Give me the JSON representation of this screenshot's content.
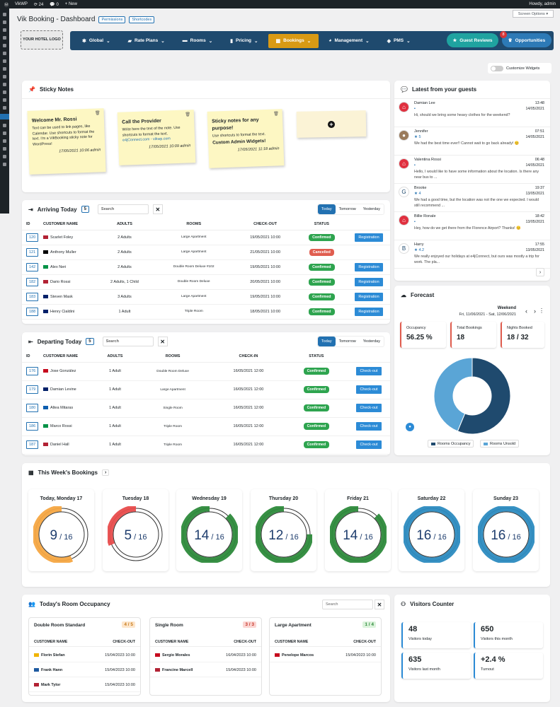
{
  "wp": {
    "site": "VikWP",
    "updates": "24",
    "comments": "0",
    "new": "+ New",
    "howdy": "Howdy, admin",
    "screen_options": "Screen Options ▾"
  },
  "page": {
    "title": "Vik Booking - Dashboard",
    "permissions": "Permissions",
    "shortcodes": "Shortcodes",
    "logo": "YOUR HOTEL LOGO"
  },
  "menu": {
    "items": [
      "Global",
      "Rate Plans",
      "Rooms",
      "Pricing",
      "Bookings",
      "Management",
      "PMS"
    ],
    "guest_reviews": "Guest Reviews",
    "opportunities": "Opportunities",
    "opp_count": "8"
  },
  "customize": "Customize Widgets",
  "sticky": {
    "title": "Sticky Notes",
    "notes": [
      {
        "title": "Welcome Mr. Rossi",
        "body": "Text can be used to link pages, like Calendar. Use shortcuts to format the text. I'm a VikBooking sticky note for WordPress!",
        "date": "17/05/2021 10:06 admin"
      },
      {
        "title": "Call the Provider",
        "body": "Write here the text of the note. Use shortcuts to format the text.",
        "link": "e4jConnect.com - vikwp.com",
        "date": "17/05/2021 10:09 admin"
      },
      {
        "title": "Sticky notes for any purpose!",
        "body": "Use shortcuts to format the text.",
        "body2": "Custom Admin Widgets!",
        "date": "17/05/2021 11:18 admin"
      }
    ]
  },
  "arriving": {
    "title": "Arriving Today",
    "count": "5",
    "search": "Search",
    "tabs": [
      "Today",
      "Tomorrow",
      "Yesterday"
    ],
    "cols": [
      "ID",
      "CUSTOMER NAME",
      "ADULTS",
      "ROOMS",
      "CHECK-OUT",
      "STATUS"
    ],
    "rows": [
      {
        "id": "120",
        "name": "Scarlet Foley",
        "adults": "2 Adults",
        "room": "Large Apartment",
        "date": "19/05/2021 10:00",
        "status": "Confirmed",
        "action": "Registration"
      },
      {
        "id": "121",
        "name": "Anthony Muller",
        "adults": "2 Adults",
        "room": "Large Apartment",
        "date": "21/05/2021 10:00",
        "status": "Cancelled",
        "action": ""
      },
      {
        "id": "142",
        "name": "Alex Neri",
        "adults": "2 Adults",
        "room": "Double Room Deluxe #102",
        "date": "19/05/2021 10:00",
        "status": "Confirmed",
        "action": "Registration"
      },
      {
        "id": "182",
        "name": "Dario Rossi",
        "adults": "2 Adults, 1 Child",
        "room": "Double Room Deluxe",
        "date": "20/05/2021 10:00",
        "status": "Confirmed",
        "action": "Registration"
      },
      {
        "id": "183",
        "name": "Steven Mask",
        "adults": "3 Adults",
        "room": "Large Apartment",
        "date": "19/05/2021 10:00",
        "status": "Confirmed",
        "action": "Registration"
      },
      {
        "id": "188",
        "name": "Henry Cialdini",
        "adults": "1 Adult",
        "room": "Triple Room",
        "date": "18/05/2021 10:00",
        "status": "Confirmed",
        "action": "Registration"
      }
    ]
  },
  "departing": {
    "title": "Departing Today",
    "count": "5",
    "search": "Search",
    "tabs": [
      "Today",
      "Tomorrow",
      "Yesterday"
    ],
    "cols": [
      "ID",
      "CUSTOMER NAME",
      "ADULTS",
      "ROOMS",
      "CHECK-IN",
      "STATUS"
    ],
    "rows": [
      {
        "id": "176",
        "name": "Jose González",
        "adults": "1 Adult",
        "room": "Double Room Deluxe",
        "date": "16/05/2021 12:00",
        "status": "Confirmed",
        "action": "Check-out"
      },
      {
        "id": "179",
        "name": "Damian Levine",
        "adults": "1 Adult",
        "room": "Large Apartment",
        "date": "16/05/2021 12:00",
        "status": "Confirmed",
        "action": "Check-out"
      },
      {
        "id": "180",
        "name": "Altea Mitaras",
        "adults": "1 Adult",
        "room": "Single Room",
        "date": "16/05/2021 12:00",
        "status": "Confirmed",
        "action": "Check-out"
      },
      {
        "id": "186",
        "name": "Marco Rossi",
        "adults": "1 Adult",
        "room": "Triple Room",
        "date": "16/05/2021 12:00",
        "status": "Confirmed",
        "action": "Check-out"
      },
      {
        "id": "187",
        "name": "Daniel Hall",
        "adults": "1 Adult",
        "room": "Triple Room",
        "date": "16/05/2021 12:00",
        "status": "Confirmed",
        "action": "Check-out"
      }
    ]
  },
  "guests": {
    "title": "Latest from your guests",
    "items": [
      {
        "name": "Damian Lee",
        "sub": "",
        "text": "Hi, should we bring some heavy clothes for the weekend?",
        "time": "13:48",
        "date": "14/05/2021"
      },
      {
        "name": "Jennifer",
        "sub": "5",
        "text": "We had the best time ever!! Cannot wait to go back already! 😊",
        "time": "07:51",
        "date": "14/05/2021"
      },
      {
        "name": "Valentina Rossi",
        "sub": "",
        "text": "Hello, I would like to have some information about the location. Is there any near bus to ...",
        "time": "06:48",
        "date": "14/05/2021"
      },
      {
        "name": "Brooke",
        "sub": "4",
        "text": "We had a good time, but the location was not the one we expected. I would still recommend ...",
        "time": "19:37",
        "date": "13/05/2021"
      },
      {
        "name": "Billie Ronale",
        "sub": "",
        "text": "Hey, how do we get there from the Florence Airport? Thanks! 😊",
        "time": "18:42",
        "date": "13/05/2021"
      },
      {
        "name": "Harry",
        "sub": "4.2",
        "text": "We really enjoyed our holidays at e4jConnect, but ours was mostly a trip for work. The pla...",
        "time": "17:55",
        "date": "13/05/2021"
      }
    ]
  },
  "forecast": {
    "title": "Forecast",
    "period": "Weekend",
    "range": "Fri, 11/06/2021 - Sat, 12/06/2021",
    "occupancy_label": "Occupancy",
    "occupancy": "56.25 %",
    "total_label": "Total Bookings",
    "total": "18",
    "nights_label": "Nights Booked",
    "nights": "18 / 32",
    "legend": [
      "Rooms Occupancy",
      "Rooms Unsold"
    ]
  },
  "chart_data": {
    "type": "pie",
    "categories": [
      "Rooms Occupancy",
      "Rooms Unsold"
    ],
    "values": [
      56.25,
      43.75
    ],
    "colors": [
      "#1f4a6e",
      "#5aa5d6"
    ]
  },
  "week": {
    "title": "This Week's Bookings",
    "days": [
      {
        "label": "Today, Monday 17",
        "value": "9",
        "total": "16",
        "color": "#f5a742"
      },
      {
        "label": "Tuesday 18",
        "value": "5",
        "total": "16",
        "color": "#e84c4c"
      },
      {
        "label": "Wednesday 19",
        "value": "14",
        "total": "16",
        "color": "#2d8a3b"
      },
      {
        "label": "Thursday 20",
        "value": "12",
        "total": "16",
        "color": "#2d8a3b"
      },
      {
        "label": "Friday 21",
        "value": "14",
        "total": "16",
        "color": "#2d8a3b"
      },
      {
        "label": "Saturday 22",
        "value": "16",
        "total": "16",
        "color": "#2c8bc0"
      },
      {
        "label": "Sunday 23",
        "value": "16",
        "total": "16",
        "color": "#2c8bc0"
      }
    ]
  },
  "occupancy": {
    "title": "Today's Room Occupancy",
    "search": "Search",
    "rooms": [
      {
        "name": "Double Room Standard",
        "badge": "4 / 5",
        "c1": "CUSTOMER NAME",
        "c2": "CHECK-OUT",
        "rows": [
          {
            "n": "Florin Stefan",
            "d": "15/04/2023 10:00"
          },
          {
            "n": "Frank Hann",
            "d": "15/04/2023 10:00"
          },
          {
            "n": "Mark Tylor",
            "d": "15/04/2023 10:00"
          }
        ]
      },
      {
        "name": "Single Room",
        "badge": "3 / 3",
        "c1": "CUSTOMER NAME",
        "c2": "CHECK-OUT",
        "rows": [
          {
            "n": "Sergio Morales",
            "d": "16/04/2023 10:00"
          },
          {
            "n": "Francine Marcell",
            "d": "15/04/2023 10:00"
          }
        ]
      },
      {
        "name": "Large Apartment",
        "badge": "1 / 4",
        "c1": "CUSTOMER NAME",
        "c2": "CHECK-OUT",
        "rows": [
          {
            "n": "Penelope Marcos",
            "d": "15/04/2023 10:00"
          }
        ]
      }
    ]
  },
  "visitors": {
    "title": "Visitors Counter",
    "items": [
      {
        "v": "48",
        "l": "Visitors today"
      },
      {
        "v": "650",
        "l": "Visitors this month"
      },
      {
        "v": "635",
        "l": "Visitors last month"
      },
      {
        "v": "+2.4 %",
        "l": "Turnout"
      }
    ]
  }
}
